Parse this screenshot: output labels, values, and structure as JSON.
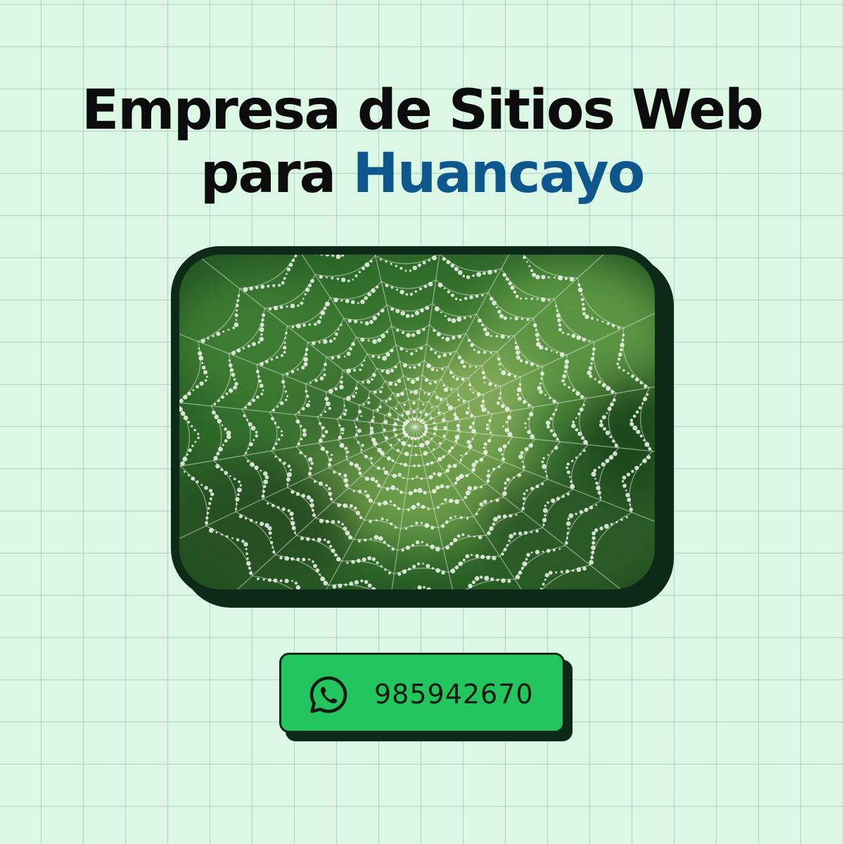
{
  "headline": {
    "line1": "Empresa de Sitios Web",
    "line2_prefix": "para ",
    "line2_accent": "Huancayo"
  },
  "colors": {
    "background": "#dcf8e5",
    "accent": "#0d578d",
    "dark": "#0c2a17",
    "button_green": "#22c55e"
  },
  "photo": {
    "icon": "spider-web-photo"
  },
  "cta": {
    "icon": "whatsapp-icon",
    "phone": "985942670"
  }
}
